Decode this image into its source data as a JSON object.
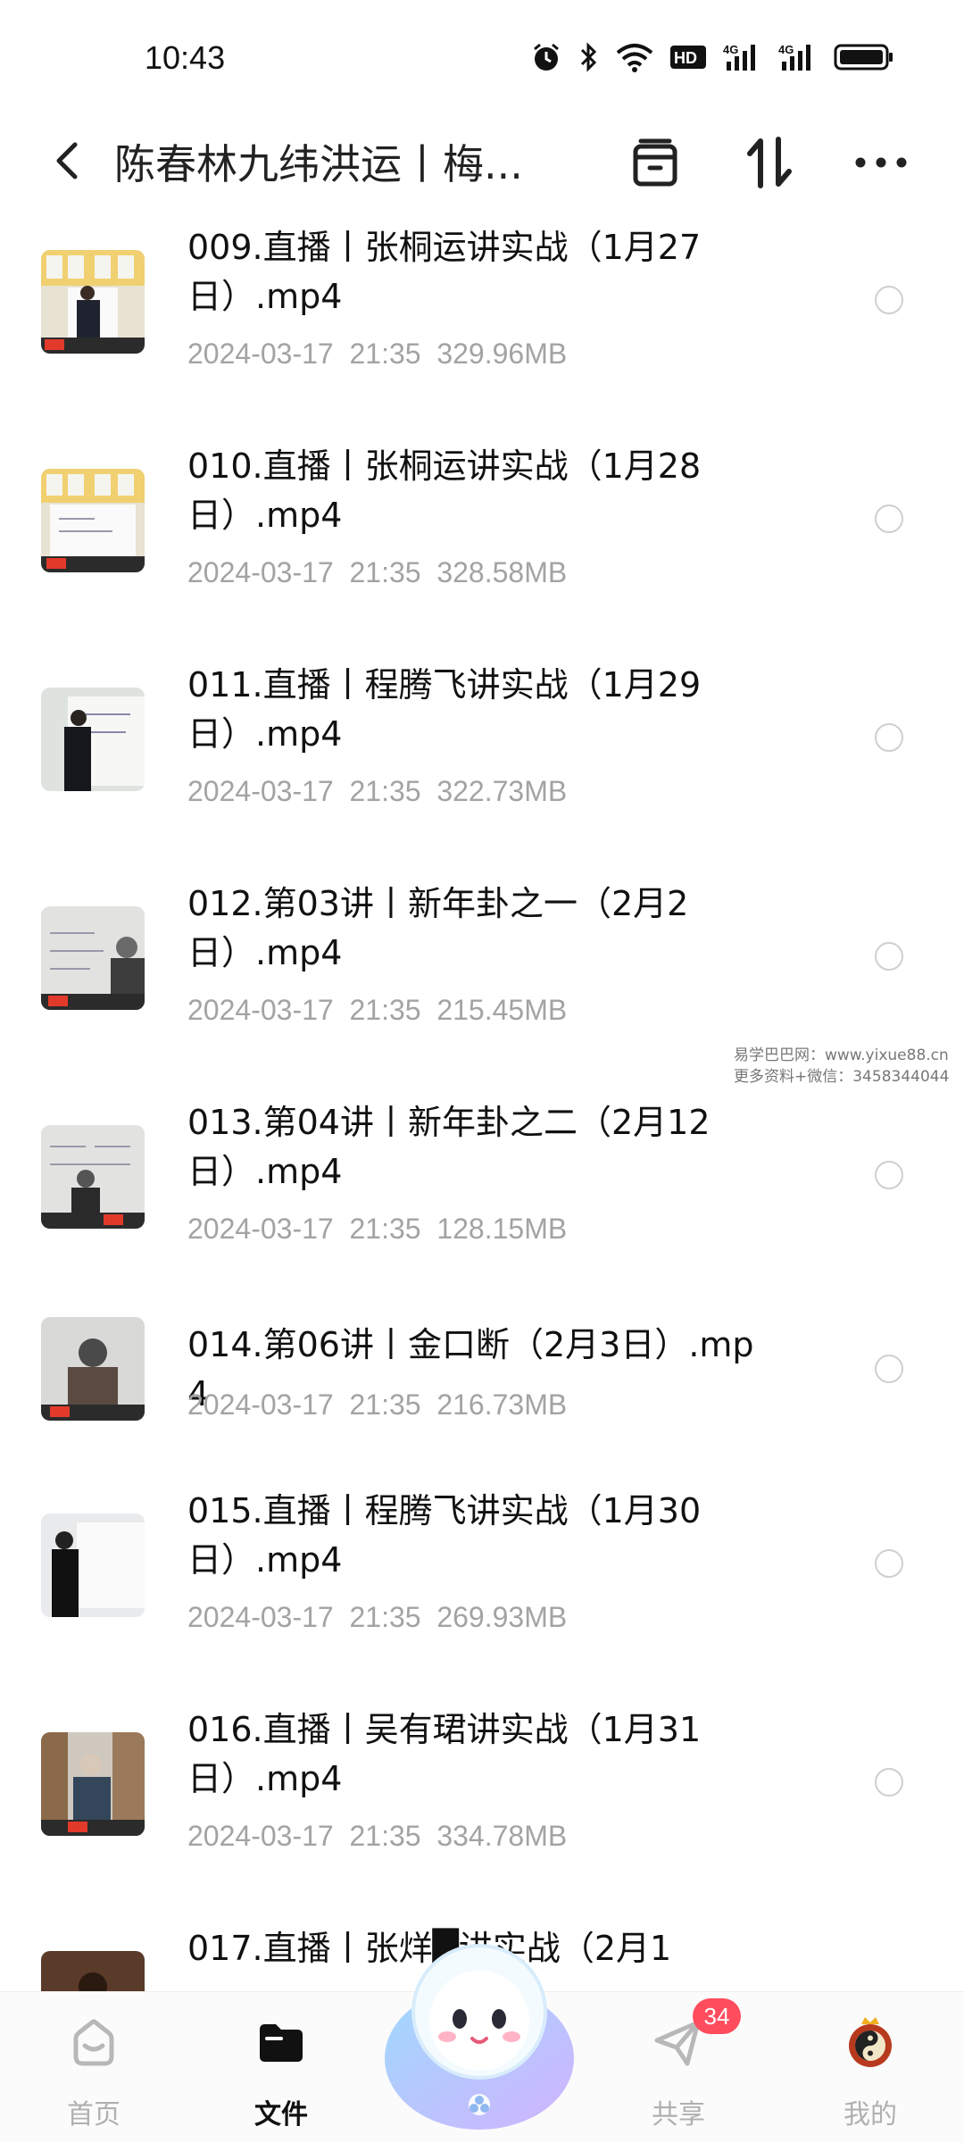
{
  "status_bar": {
    "time": "10:43",
    "icons": [
      "alarm-icon",
      "bluetooth-icon",
      "wifi-icon",
      "hd-icon",
      "signal-4g-icon",
      "signal-4g-icon",
      "battery-icon"
    ],
    "hd_label": "HD",
    "net1_label": "4G",
    "net2_label": "4G"
  },
  "header": {
    "title": "陈春林九纬洪运丨梅...",
    "icons": [
      "chevron-left-icon",
      "archive-icon",
      "sort-icon",
      "more-icon"
    ]
  },
  "files": [
    {
      "name": "009.直播丨张桐运讲实战（1月27日）.mp4",
      "date": "2024-03-17  21:35",
      "size": "329.96MB"
    },
    {
      "name": "010.直播丨张桐运讲实战（1月28日）.mp4",
      "date": "2024-03-17  21:35",
      "size": "328.58MB"
    },
    {
      "name": "011.直播丨程腾飞讲实战（1月29日）.mp4",
      "date": "2024-03-17  21:35",
      "size": "322.73MB"
    },
    {
      "name": "012.第03讲丨新年卦之一（2月2日）.mp4",
      "date": "2024-03-17  21:35",
      "size": "215.45MB"
    },
    {
      "name": "013.第04讲丨新年卦之二（2月12日）.mp4",
      "date": "2024-03-17  21:35",
      "size": "128.15MB"
    },
    {
      "name": "014.第06讲丨金口断（2月3日）.mp4",
      "date": "2024-03-17  21:35",
      "size": "216.73MB"
    },
    {
      "name": "015.直播丨程腾飞讲实战（1月30日）.mp4",
      "date": "2024-03-17  21:35",
      "size": "269.93MB"
    },
    {
      "name": "016.直播丨吴有珺讲实战（1月31日）.mp4",
      "date": "2024-03-17  21:35",
      "size": "334.78MB"
    },
    {
      "name": "017.直播丨张烊█讲实战（2月1",
      "date": "",
      "size": ""
    }
  ],
  "watermark": {
    "line1": "易学巴巴网：www.yixue88.cn",
    "line2": "更多资料+微信：3458344044"
  },
  "bottom_nav": {
    "items": [
      {
        "label": "首页",
        "icon": "home-icon"
      },
      {
        "label": "文件",
        "icon": "folder-icon"
      },
      {
        "label": "",
        "icon": "mascot-icon"
      },
      {
        "label": "共享",
        "icon": "share-icon"
      },
      {
        "label": "我的",
        "icon": "profile-avatar-icon"
      }
    ],
    "share_badge": "34",
    "active": "文件"
  },
  "colors": {
    "text": "#111111",
    "meta": "#a3a3a3",
    "badge": "#ff4d5e",
    "inactive_nav": "#b0b0b0"
  }
}
